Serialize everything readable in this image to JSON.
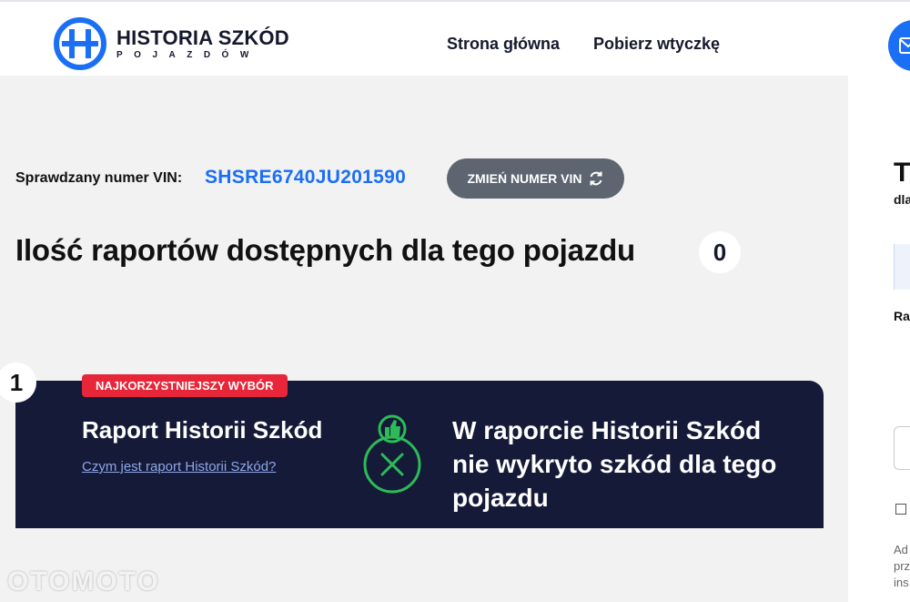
{
  "brand": {
    "title": "HISTORIA SZKÓD",
    "subtitle": "POJAZDÓW",
    "accent_color": "#1a6ff5"
  },
  "nav": {
    "home": "Strona główna",
    "plugin": "Pobierz wtyczkę"
  },
  "vin": {
    "label": "Sprawdzany numer VIN:",
    "value": "SHSRE6740JU201590",
    "change_button": "ZMIEŃ NUMER VIN",
    "change_icon": "refresh-icon"
  },
  "reports": {
    "title": "Ilość raportów dostępnych dla tego pojazdu",
    "count": "0"
  },
  "card": {
    "index": "1",
    "badge": "NAJKORZYSTNIEJSZY WYBÓR",
    "title": "Raport Historii Szkód",
    "link": "Czym jest raport Historii Szkód?",
    "result": "W raporcie Historii Szkód nie wykryto szkód dla tego pojazdu",
    "status_icons": [
      "thumbs-up-icon",
      "x-circle-icon"
    ],
    "status_color": "#2dbb57",
    "badge_color": "#e8263a"
  },
  "right_panel": {
    "title": "T",
    "subtitle": "dla",
    "label": "Ra",
    "small_text_lines": [
      "Ad",
      "prz",
      "ins"
    ]
  },
  "watermark": "OTOMOTO"
}
